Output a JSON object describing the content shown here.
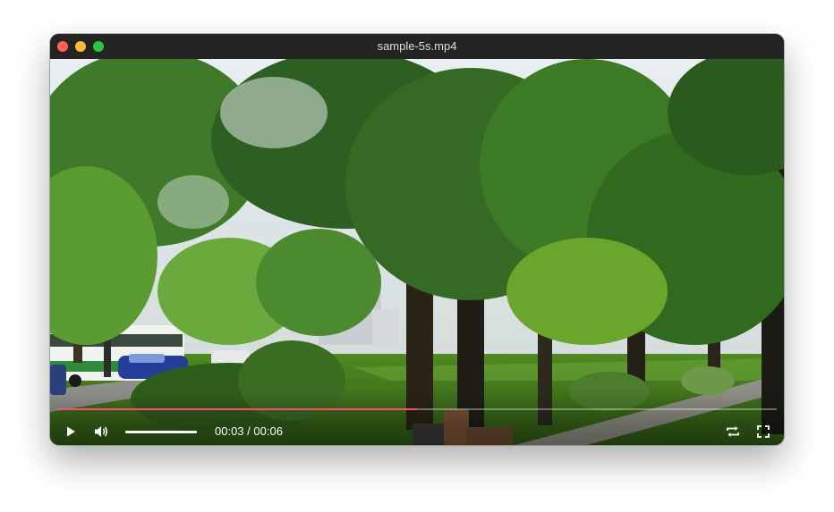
{
  "window": {
    "title": "sample-5s.mp4"
  },
  "player": {
    "current_time": "00:03",
    "separator": " / ",
    "duration": "00:06",
    "progress_fraction": 0.5,
    "volume_fraction": 1.0,
    "accent_color": "#ff4a6e"
  },
  "icons": {
    "play": "play-icon",
    "volume": "volume-icon",
    "loop": "loop-icon",
    "fullscreen": "fullscreen-icon"
  }
}
